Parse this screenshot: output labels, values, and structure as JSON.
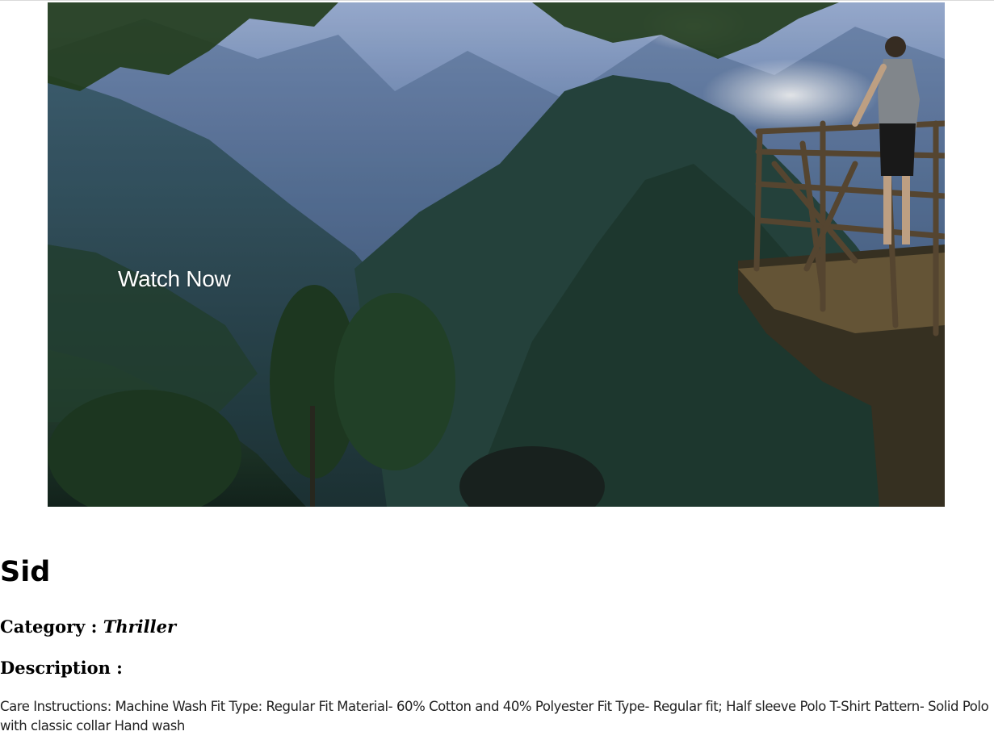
{
  "hero": {
    "cta_label": "Watch Now",
    "sky_color": "#7f98c4",
    "mountain_color": "#2f4b66",
    "foliage_color": "#2d4a2a"
  },
  "movie": {
    "title": "Sid",
    "category_label": "Category : ",
    "category_value": "Thriller",
    "description_label": "Description :",
    "description_text": "Care Instructions: Machine Wash Fit Type: Regular Fit Material- 60% Cotton and 40% Polyester Fit Type- Regular fit; Half sleeve Polo T-Shirt Pattern- Solid Polo with classic collar Hand wash"
  }
}
